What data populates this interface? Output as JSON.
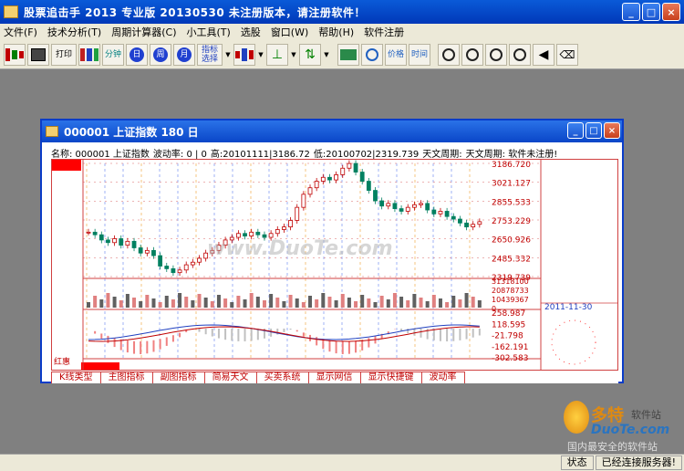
{
  "app": {
    "title": "股票追击手  2013  专业版  20130530     未注册版本，请注册软件！"
  },
  "window_buttons": {
    "minimize": "_",
    "maximize": "□",
    "close": "×"
  },
  "menu": [
    "文件(F)",
    "技术分析(T)",
    "周期计算器(C)",
    "小工具(T)",
    "选股",
    "窗口(W)",
    "帮助(H)",
    "软件注册"
  ],
  "toolbar": {
    "print": "打印",
    "minute": "分钟",
    "day": "日",
    "week": "周",
    "month": "月",
    "indicator_select": "指标选择",
    "price": "价格",
    "time": "时间"
  },
  "child": {
    "title": "000001  上证指数  180  日",
    "info": {
      "name": "名称: 000001  上证指数",
      "volatility": "波动率: 0  |  0",
      "high": "高:20101111|3186.72",
      "low": "低:20100702|2319.739",
      "astro1": "天文周期:",
      "astro2": "天文周期: 软件未注册!"
    },
    "side_label": "红惠",
    "date_label": "2011-11-30",
    "watermark": "www.DuoTe.com",
    "tabs": [
      "K线类型",
      "主图指标",
      "副图指标",
      "简易天文",
      "买卖系统",
      "显示网信",
      "显示快捷键",
      "波动率"
    ]
  },
  "chart_data": {
    "type": "candlestick",
    "price_axis": [
      "3186.720",
      "3021.127",
      "2855.533",
      "2753.229",
      "2650.926",
      "2485.332",
      "2319.739"
    ],
    "volume_axis": [
      "31318100",
      "20878733",
      "10439367",
      "0"
    ],
    "macd_axis": [
      "258.987",
      "118.595",
      "-21.798",
      "-162.191",
      "-302.583"
    ],
    "ylim": [
      2319.739,
      3186.72
    ],
    "close_series": [
      2660,
      2640,
      2600,
      2580,
      2610,
      2560,
      2590,
      2540,
      2500,
      2520,
      2480,
      2400,
      2380,
      2350,
      2370,
      2410,
      2430,
      2460,
      2500,
      2520,
      2560,
      2600,
      2620,
      2650,
      2630,
      2660,
      2640,
      2620,
      2650,
      2680,
      2700,
      2750,
      2850,
      2950,
      3000,
      3050,
      3080,
      3060,
      3100,
      3150,
      3186,
      3120,
      3050,
      2980,
      2900,
      2860,
      2880,
      2840,
      2820,
      2850,
      2870,
      2880,
      2830,
      2800,
      2820,
      2780,
      2760,
      2730,
      2700,
      2720,
      2740
    ]
  },
  "status": {
    "state": "状态",
    "connected": "已经连接服务器!"
  },
  "branding": {
    "name": "多特",
    "name_suffix": "软件站",
    "url": "DuoTe.com",
    "slogan": "国内最安全的软件站"
  },
  "colors": {
    "title_bar": "#0a4ad0",
    "grid_red": "#d04040",
    "grid_orange": "#f0a030",
    "grid_blue": "#6080f0",
    "candle_up": "#c00000",
    "candle_down": "#008060"
  }
}
